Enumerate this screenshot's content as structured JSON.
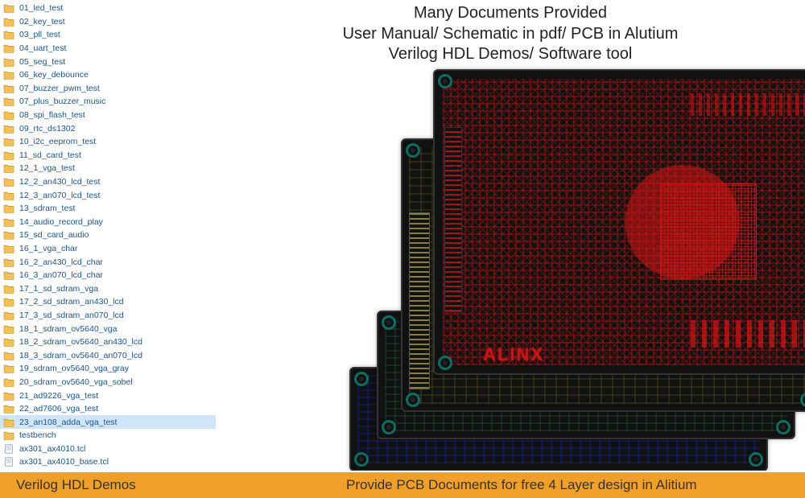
{
  "headline": {
    "line1": "Many Documents Provided",
    "line2": "User Manual/ Schematic in pdf/ PCB in Alutium",
    "line3": "Verilog HDL Demos/ Software tool"
  },
  "footer": {
    "left": "Verilog HDL Demos",
    "right": "Provide PCB Documents for free  4 Layer design in Alitium"
  },
  "pcb_brand": "ALINX",
  "files": [
    {
      "type": "folder",
      "name": "01_led_test"
    },
    {
      "type": "folder",
      "name": "02_key_test"
    },
    {
      "type": "folder",
      "name": "03_pll_test"
    },
    {
      "type": "folder",
      "name": "04_uart_test"
    },
    {
      "type": "folder",
      "name": "05_seg_test"
    },
    {
      "type": "folder",
      "name": "06_key_debounce"
    },
    {
      "type": "folder",
      "name": "07_buzzer_pwm_test"
    },
    {
      "type": "folder",
      "name": "07_plus_buzzer_music"
    },
    {
      "type": "folder",
      "name": "08_spi_flash_test"
    },
    {
      "type": "folder",
      "name": "09_rtc_ds1302"
    },
    {
      "type": "folder",
      "name": "10_i2c_eeprom_test"
    },
    {
      "type": "folder",
      "name": "11_sd_card_test"
    },
    {
      "type": "folder",
      "name": "12_1_vga_test"
    },
    {
      "type": "folder",
      "name": "12_2_an430_lcd_test"
    },
    {
      "type": "folder",
      "name": "12_3_an070_lcd_test"
    },
    {
      "type": "folder",
      "name": "13_sdram_test"
    },
    {
      "type": "folder",
      "name": "14_audio_record_play"
    },
    {
      "type": "folder",
      "name": "15_sd_card_audio"
    },
    {
      "type": "folder",
      "name": "16_1_vga_char"
    },
    {
      "type": "folder",
      "name": "16_2_an430_lcd_char"
    },
    {
      "type": "folder",
      "name": "16_3_an070_lcd_char"
    },
    {
      "type": "folder",
      "name": "17_1_sd_sdram_vga"
    },
    {
      "type": "folder",
      "name": "17_2_sd_sdram_an430_lcd"
    },
    {
      "type": "folder",
      "name": "17_3_sd_sdram_an070_lcd"
    },
    {
      "type": "folder",
      "name": "18_1_sdram_ov5640_vga"
    },
    {
      "type": "folder",
      "name": "18_2_sdram_ov5640_an430_lcd"
    },
    {
      "type": "folder",
      "name": "18_3_sdram_ov5640_an070_lcd"
    },
    {
      "type": "folder",
      "name": "19_sdram_ov5640_vga_gray"
    },
    {
      "type": "folder",
      "name": "20_sdram_ov5640_vga_sobel"
    },
    {
      "type": "folder",
      "name": "21_ad9226_vga_test"
    },
    {
      "type": "folder",
      "name": "22_ad7606_vga_test"
    },
    {
      "type": "folder",
      "name": "23_an108_adda_vga_test",
      "selected": true
    },
    {
      "type": "folder",
      "name": "testbench"
    },
    {
      "type": "file",
      "name": "ax301_ax4010.tcl"
    },
    {
      "type": "file",
      "name": "ax301_ax4010_base.tcl"
    }
  ]
}
